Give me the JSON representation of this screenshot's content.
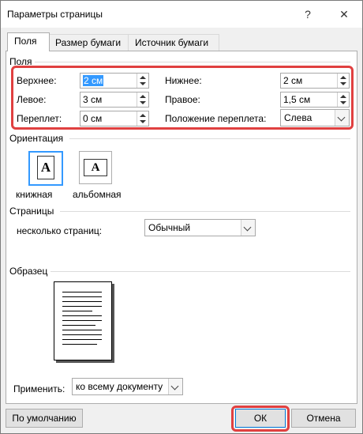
{
  "window": {
    "title": "Параметры страницы",
    "help": "?",
    "close": "✕"
  },
  "tabs": [
    {
      "label": "Поля",
      "active": true
    },
    {
      "label": "Размер бумаги",
      "active": false
    },
    {
      "label": "Источник бумаги",
      "active": false
    }
  ],
  "margins": {
    "group_label": "Поля",
    "top_label": "Верхнее:",
    "top_value": "2 см",
    "bottom_label": "Нижнее:",
    "bottom_value": "2 см",
    "left_label": "Левое:",
    "left_value": "3 см",
    "right_label": "Правое:",
    "right_value": "1,5 см",
    "gutter_label": "Переплет:",
    "gutter_value": "0 см",
    "gutter_pos_label": "Положение переплета:",
    "gutter_pos_value": "Слева"
  },
  "orientation": {
    "group_label": "Ориентация",
    "portrait_label": "книжная",
    "landscape_label": "альбомная",
    "icon_letter": "A",
    "selected": "portrait"
  },
  "pages": {
    "group_label": "Страницы",
    "multiple_label": "несколько страниц:",
    "multiple_value": "Обычный"
  },
  "preview": {
    "group_label": "Образец"
  },
  "apply": {
    "label": "Применить:",
    "value": "ко всему документу"
  },
  "buttons": {
    "default_label": "По умолчанию",
    "ok_label": "ОК",
    "cancel_label": "Отмена"
  },
  "colors": {
    "highlight": "#e04040",
    "selection": "#3399ff"
  }
}
